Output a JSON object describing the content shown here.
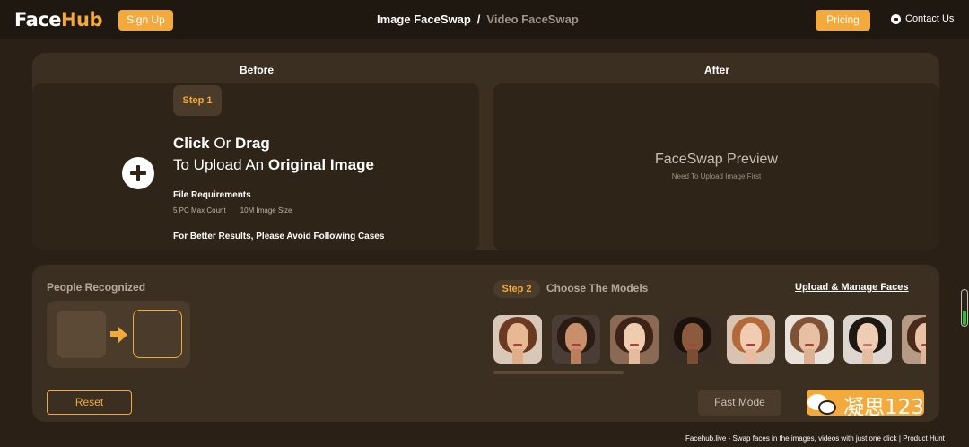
{
  "header": {
    "logo_part1": "Face",
    "logo_part2": "Hub",
    "signup_label": "Sign Up",
    "tab_image": "Image FaceSwap",
    "tab_separator": "/",
    "tab_video": "Video FaceSwap",
    "pricing_label": "Pricing",
    "contact_label": "Contact Us"
  },
  "colors": {
    "accent": "#f3a93b",
    "background": "#2b2015",
    "panel": "#3b2f22"
  },
  "before": {
    "title": "Before",
    "step_label": "Step 1",
    "click": "Click",
    "or": " Or ",
    "drag": "Drag",
    "to_upload": "To Upload An ",
    "original_image": "Original Image",
    "requirements_title": "File Requirements",
    "req_count": "5 PC Max Count",
    "req_size": "10M Image Size",
    "avoid_title": "For Better Results, Please Avoid Following Cases"
  },
  "after": {
    "title": "After",
    "preview_title": "FaceSwap Preview",
    "preview_subtitle": "Need To Upload Image First"
  },
  "people": {
    "title": "People Recognized",
    "reset_label": "Reset"
  },
  "models": {
    "step_label": "Step 2",
    "title": "Choose The Models",
    "manage_link": "Upload & Manage Faces",
    "faces": [
      "model-face-1",
      "model-face-2",
      "model-face-3",
      "model-face-4",
      "model-face-5",
      "model-face-6",
      "model-face-7",
      "model-face-8"
    ]
  },
  "actions": {
    "fast_mode_label": "Fast Mode"
  },
  "watermark": {
    "text": "凝思123"
  },
  "footer": {
    "image_alt": "Facehub.live - Swap faces in the images, videos with just one click | Product Hunt"
  }
}
